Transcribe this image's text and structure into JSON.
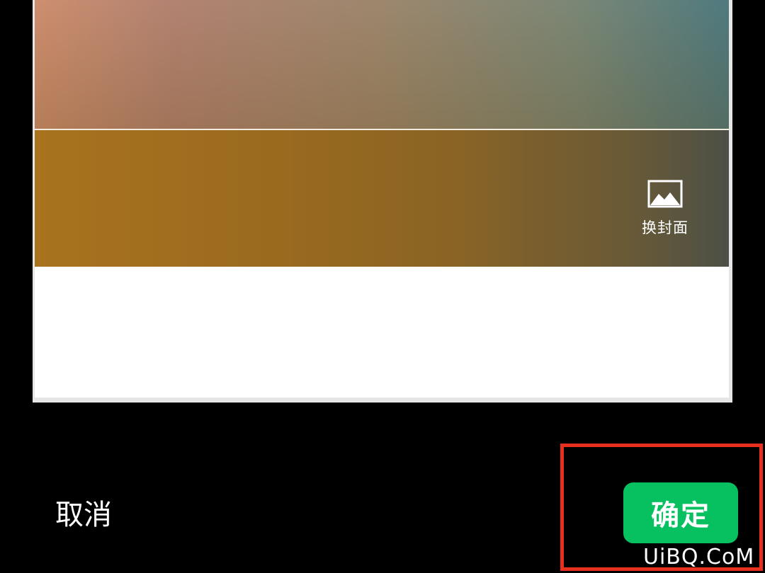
{
  "cover_editor": {
    "change_cover_label": "换封面",
    "change_cover_icon": "image-icon"
  },
  "actions": {
    "cancel_label": "取消",
    "confirm_label": "确定"
  },
  "watermark": {
    "text": "UiBQ.CoM"
  },
  "colors": {
    "confirm_green": "#07c160",
    "highlight_red": "#e8301e",
    "background": "#000000"
  }
}
